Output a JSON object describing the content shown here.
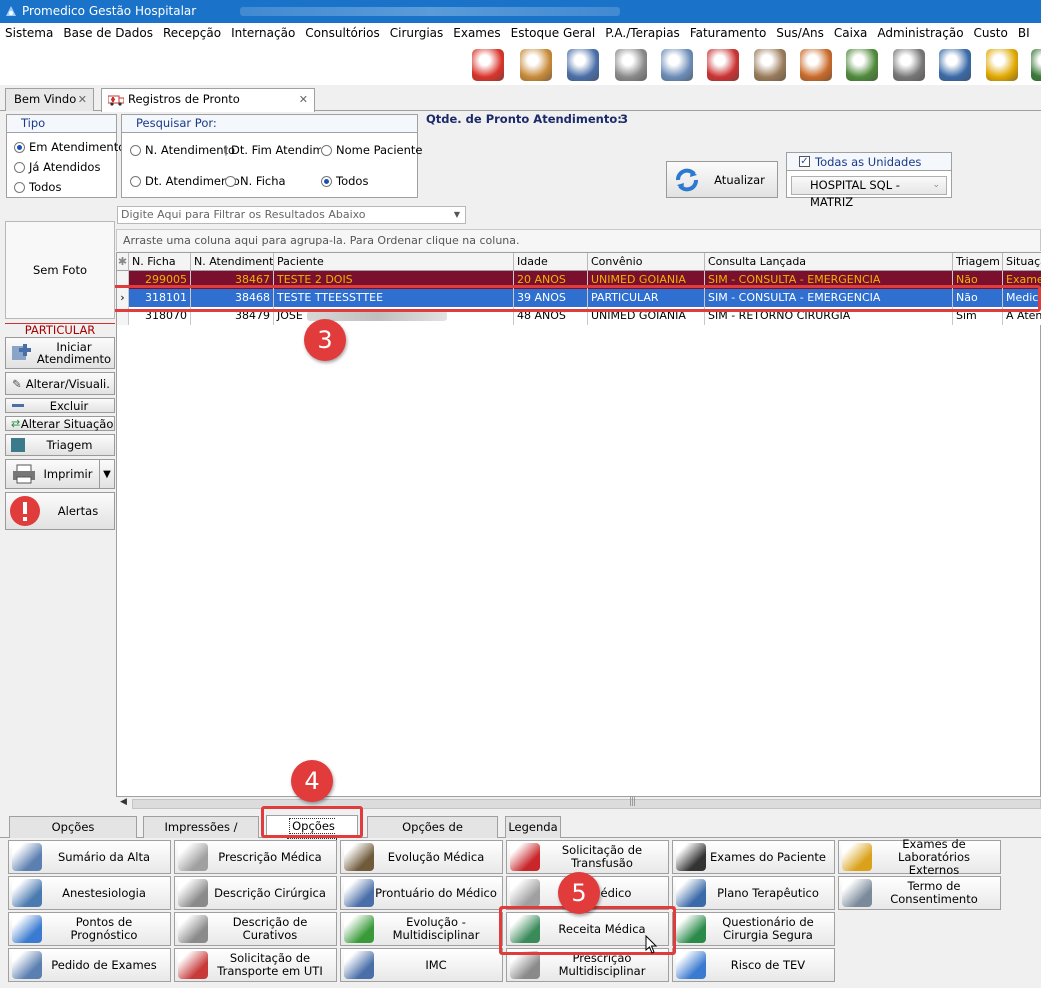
{
  "window": {
    "title": "Promedico Gestão Hospitalar"
  },
  "menu": [
    "Sistema",
    "Base de Dados",
    "Recepção",
    "Internação",
    "Consultórios",
    "Cirurgias",
    "Exames",
    "Estoque Geral",
    "P.A./Terapias",
    "Faturamento",
    "Sus/Ans",
    "Caixa",
    "Administração",
    "Custo",
    "BI"
  ],
  "toolbar_icons": [
    {
      "name": "refresh-users-icon",
      "color": "#d9342b"
    },
    {
      "name": "reception-icon",
      "color": "#c98b3a"
    },
    {
      "name": "doctor-icon",
      "color": "#4a6fa8"
    },
    {
      "name": "prescription-icon",
      "color": "#8a8a8a"
    },
    {
      "name": "hospital-bed-icon",
      "color": "#6c8db8"
    },
    {
      "name": "ambulance-icon",
      "color": "#cc3333"
    },
    {
      "name": "lab-icon",
      "color": "#9a7b5a"
    },
    {
      "name": "stock-icon",
      "color": "#c96a2a"
    },
    {
      "name": "money-icon",
      "color": "#4f8a3a"
    },
    {
      "name": "safe-icon",
      "color": "#777777"
    },
    {
      "name": "cash-register-icon",
      "color": "#3a6aa8"
    },
    {
      "name": "phone-icon",
      "color": "#e0a800"
    },
    {
      "name": "book-icon",
      "color": "#3a7a3a"
    }
  ],
  "tabs": [
    {
      "label": "Bem Vindo"
    },
    {
      "label": "Registros de Pronto Atendimento"
    }
  ],
  "tipo": {
    "title": "Tipo",
    "options": [
      "Em Atendimento",
      "Já Atendidos",
      "Todos"
    ]
  },
  "pesquisar": {
    "title": "Pesquisar Por:",
    "options": [
      "N. Atendimento",
      "Dt. Fim Atendime",
      "Nome Paciente",
      "Dt. Atendimento",
      "N. Ficha",
      "Todos"
    ]
  },
  "qtde": {
    "label": "Qtde. de Pronto Atendimento:",
    "value": "3"
  },
  "atualizar_label": "Atualizar",
  "unidades": {
    "checkbox_label": "Todas as Unidades",
    "value": "HOSPITAL SQL - MATRIZ"
  },
  "filter_placeholder": "Digite Aqui para Filtrar os Resultados Abaixo",
  "group_hint": "Arraste uma coluna aqui para agrupa-la. Para Ordenar clique na coluna.",
  "columns": [
    "N. Ficha",
    "N. Atendimento",
    "Paciente",
    "Idade",
    "Convênio",
    "Consulta Lançada",
    "Triagem",
    "Situação"
  ],
  "rows": [
    [
      "299005",
      "38467",
      "TESTE 2 DOIS",
      "20 ANOS",
      "UNIMED GOIANIA",
      "SIM - CONSULTA - EMERGENCIA",
      "Não",
      "Exame"
    ],
    [
      "318101",
      "38468",
      "TESTE TTEESSTTEE",
      "39 ANOS",
      "PARTICULAR",
      "SIM - CONSULTA - EMERGENCIA",
      "Não",
      "Medica"
    ],
    [
      "318070",
      "38479",
      "JOSE",
      "48 ANOS",
      "UNIMED GOIANIA",
      "SIM - RETORNO CIRURGIA",
      "Sim",
      "A Atend"
    ]
  ],
  "photo_label": "Sem Foto",
  "convenio_label": "PARTICULAR",
  "side_buttons": {
    "iniciar": "Iniciar Atendimento",
    "alterar": "Alterar/Visuali.",
    "excluir": "Excluir",
    "situacao": "Alterar Situação",
    "triagem": "Triagem",
    "imprimir": "Imprimir",
    "alertas": "Alertas"
  },
  "badges": [
    "3",
    "4",
    "5"
  ],
  "bottom_tabs": [
    "Opções Adminstrativas",
    "Impressões / Outros",
    "Opções Médicas",
    "Opções de Enfermagem",
    "Legenda"
  ],
  "actions": [
    {
      "label": "Sumário da Alta",
      "icon": "summary-icon",
      "color": "#5a7fb0"
    },
    {
      "label": "Prescrição Médica",
      "icon": "prescription-pad-icon",
      "color": "#a0a0a0"
    },
    {
      "label": "Evolução Médica",
      "icon": "doctors-icon",
      "color": "#6f5a3a"
    },
    {
      "label": "Solicitação de Transfusão",
      "icon": "blood-bag-icon",
      "color": "#c8262a"
    },
    {
      "label": "Exames do Paciente",
      "icon": "binoculars-icon",
      "color": "#333333"
    },
    {
      "label": "Exames de Laboratórios Externos",
      "icon": "lab-flask-icon",
      "color": "#d9a21a"
    },
    {
      "label": "Anestesiologia",
      "icon": "syringe-icon",
      "color": "#4a7ab0"
    },
    {
      "label": "Descrição Cirúrgica",
      "icon": "surgery-doc-icon",
      "color": "#8a8a8a"
    },
    {
      "label": "Prontuário do Médico",
      "icon": "doctor-record-icon",
      "color": "#4a6fa8"
    },
    {
      "label": "do Médico",
      "icon": "certificate-icon",
      "color": "#a0a0a0"
    },
    {
      "label": "Plano Terapêutico",
      "icon": "therapy-plan-icon",
      "color": "#3a6aa8"
    },
    {
      "label": "Termo de Consentimento",
      "icon": "consent-icon",
      "color": "#7a8a9a"
    },
    {
      "label": "Pontos de Prognóstico",
      "icon": "prognosis-icon",
      "color": "#3a7ad0"
    },
    {
      "label": "Descrição de Curativos",
      "icon": "bandage-icon",
      "color": "#8a8a8a"
    },
    {
      "label": "Evolução - Multidisciplinar",
      "icon": "evolution-chart-icon",
      "color": "#3a9a3a"
    },
    {
      "label": "Receita Médica",
      "icon": "medicine-bottle-icon",
      "color": "#3a8a5a"
    },
    {
      "label": "Questionário de Cirurgia Segura",
      "icon": "surgery-checklist-icon",
      "color": "#2a8a4a"
    },
    {
      "label": "Pedido de Exames",
      "icon": "exam-request-icon",
      "color": "#5a7fb0"
    },
    {
      "label": "Solicitação de Transporte em UTI",
      "icon": "ambulance-icon",
      "color": "#c83a3a"
    },
    {
      "label": "IMC",
      "icon": "bmi-icon",
      "color": "#4a6fa8"
    },
    {
      "label": "Prescrição Multidisciplinar",
      "icon": "multi-prescription-icon",
      "color": "#8a8a8a"
    },
    {
      "label": "Risco de TEV",
      "icon": "risk-icon",
      "color": "#3a7ad0"
    }
  ]
}
